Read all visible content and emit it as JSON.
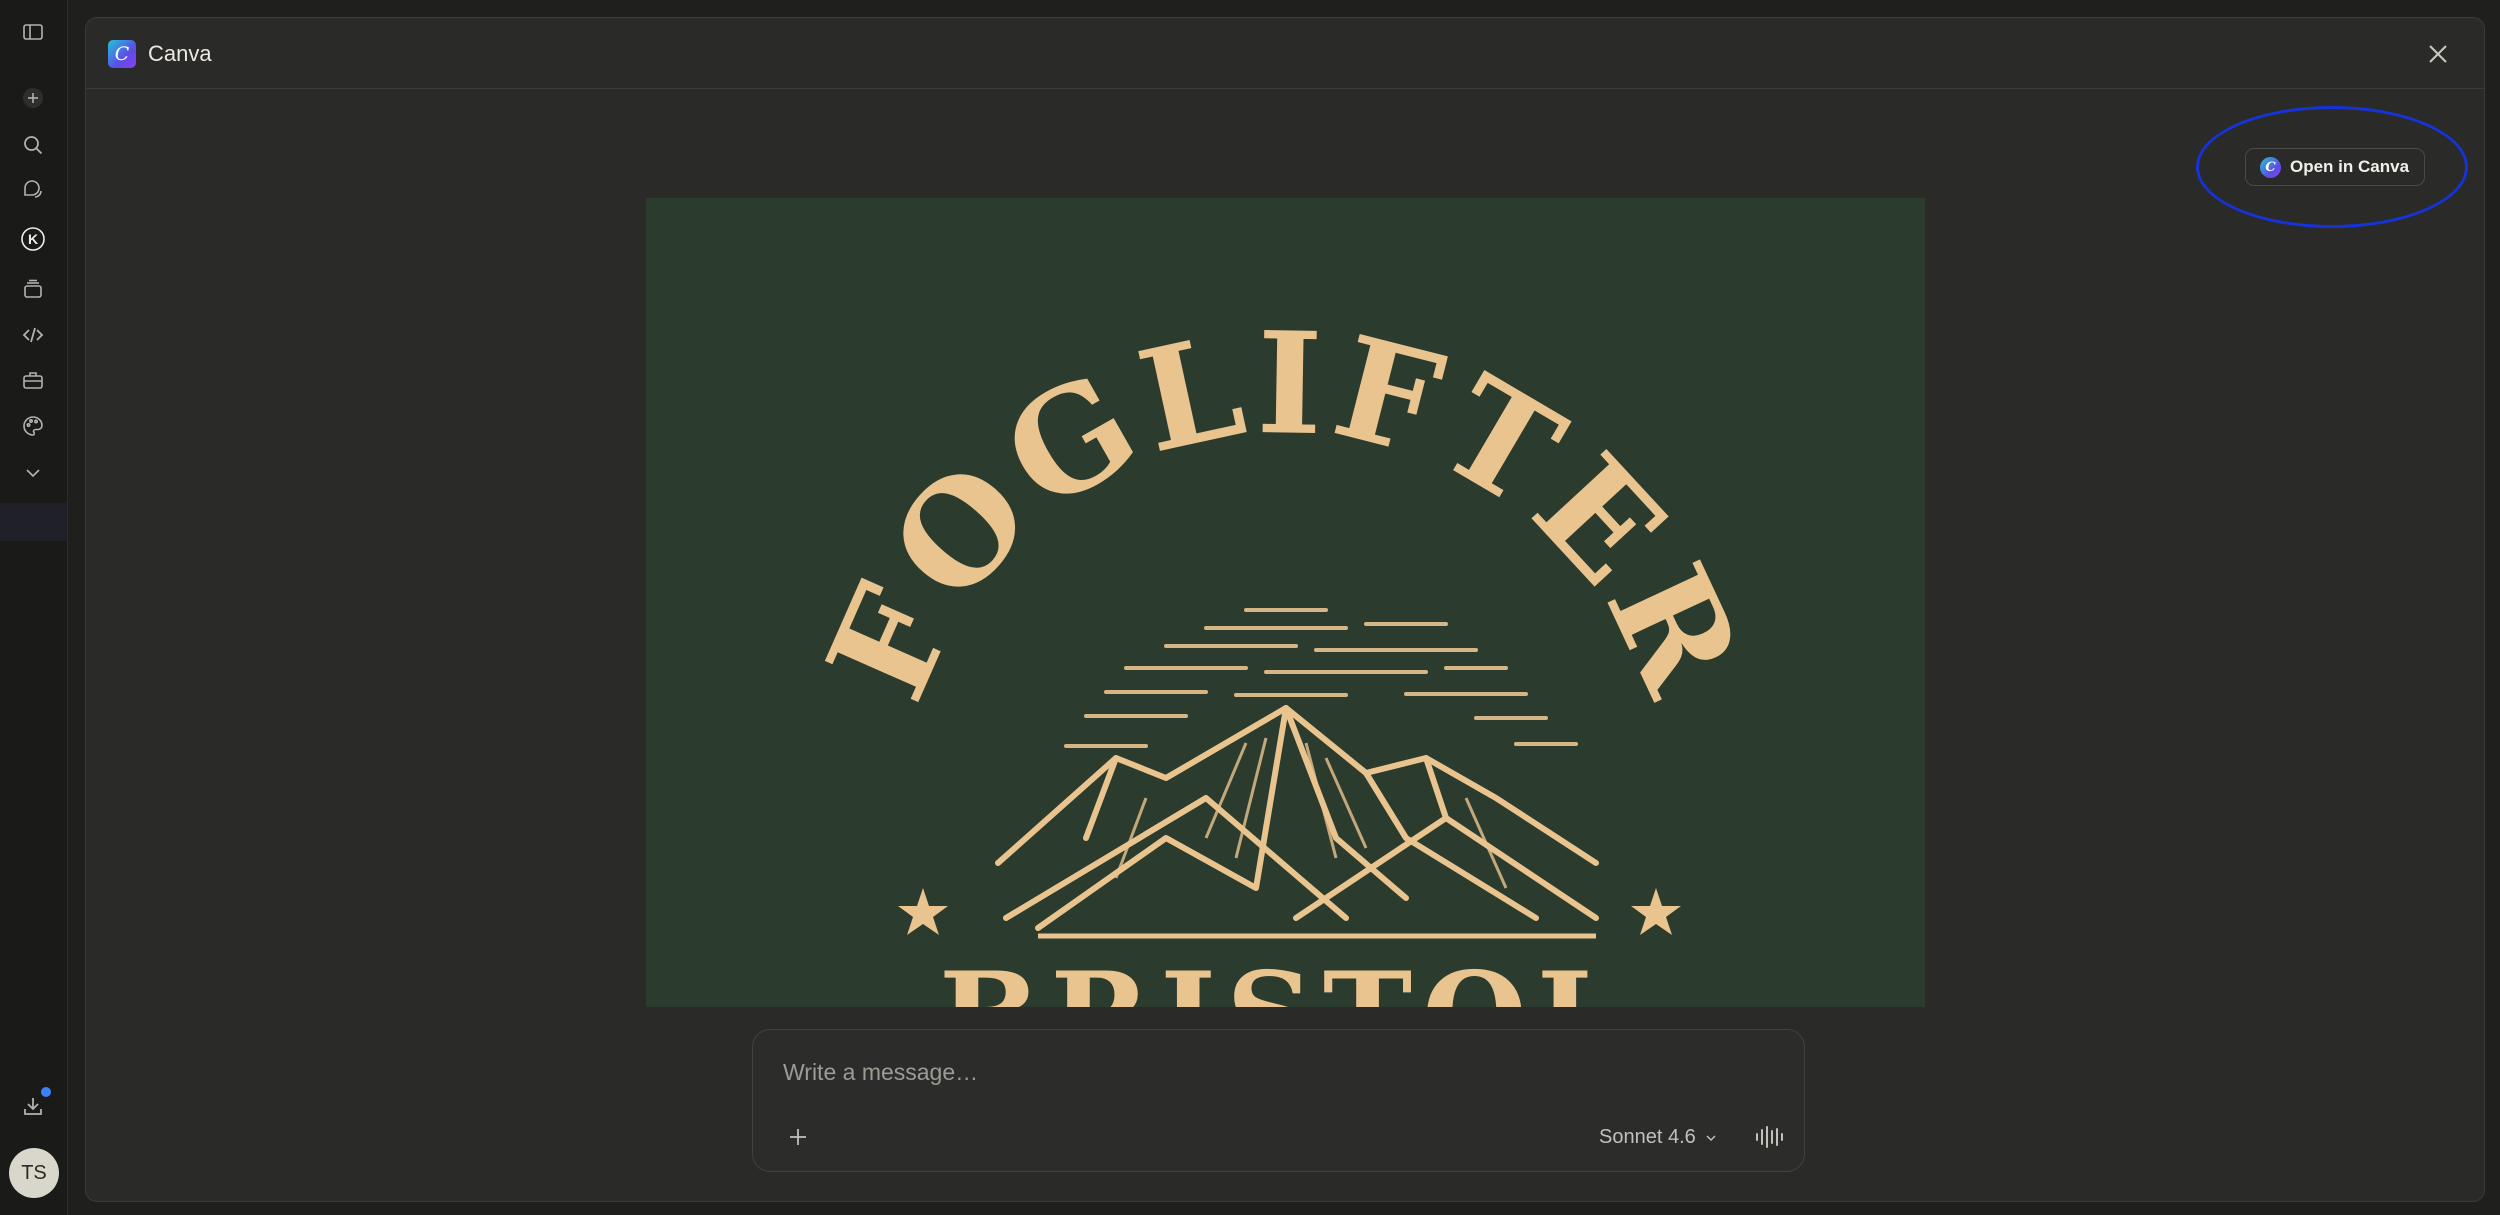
{
  "app": {
    "title": "Canva"
  },
  "header": {
    "close_icon": "close-icon"
  },
  "actions": {
    "open_in_canva_label": "Open in Canva"
  },
  "design": {
    "brand_text": "FOGLIFTER",
    "location_text": "BRISTOL",
    "background_color": "#2b3b2d",
    "ink_color": "#e9c48f"
  },
  "composer": {
    "placeholder": "Write a message…",
    "model_label": "Sonnet 4.6"
  },
  "user": {
    "initials": "TS"
  },
  "sidebar": {
    "icons": [
      "sidebar-toggle-icon",
      "plus-icon",
      "search-icon",
      "chats-icon",
      "k-logo-icon",
      "projects-icon",
      "code-icon",
      "toolbox-icon",
      "palette-icon",
      "chevron-down-icon",
      "download-icon"
    ]
  },
  "colors": {
    "annotation": "#1533d6",
    "notification": "#3b82f6"
  }
}
